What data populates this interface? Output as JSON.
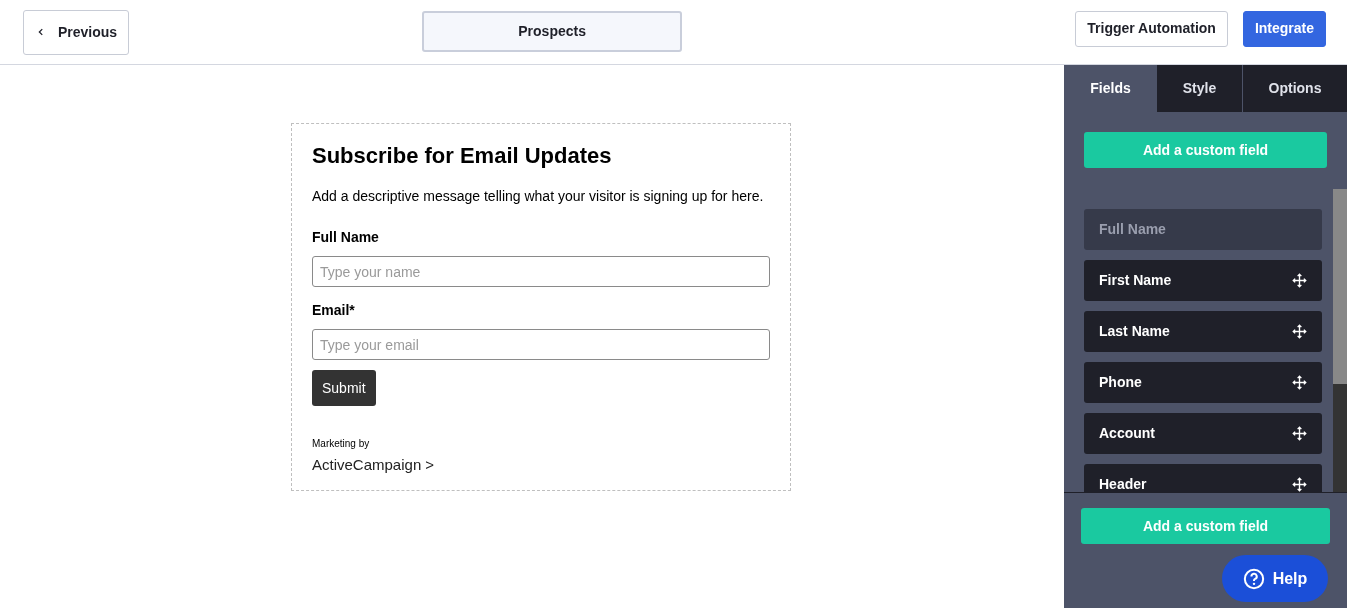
{
  "header": {
    "back_button": "Previous",
    "title": "Prospects",
    "buttons": [
      {
        "label": "Trigger Automation",
        "kind": "secondary"
      },
      {
        "label": "Integrate",
        "kind": "primary"
      }
    ]
  },
  "form": {
    "title": "Subscribe for Email Updates",
    "description": "Add a descriptive message telling what your visitor is signing up for here.",
    "fields": [
      {
        "label": "Full Name",
        "placeholder": "Type your name"
      },
      {
        "label": "Email*",
        "placeholder": "Type your email"
      }
    ],
    "submit": "Submit",
    "marketing_by": "Marketing by",
    "brand": "ActiveCampaign",
    "brand_arrow": ">"
  },
  "sidebar": {
    "tabs": [
      {
        "label": "Fields",
        "selected": true
      },
      {
        "label": "Style",
        "selected": false
      },
      {
        "label": "Options",
        "selected": false
      }
    ],
    "add_button_top": "Add a custom field",
    "fields": [
      {
        "label": "Full Name",
        "disabled": true
      },
      {
        "label": "First Name",
        "disabled": false
      },
      {
        "label": "Last Name",
        "disabled": false
      },
      {
        "label": "Phone",
        "disabled": false
      },
      {
        "label": "Account",
        "disabled": false
      },
      {
        "label": "Header",
        "disabled": false
      }
    ],
    "add_button_bottom": "Add a custom field",
    "help": "Help"
  }
}
